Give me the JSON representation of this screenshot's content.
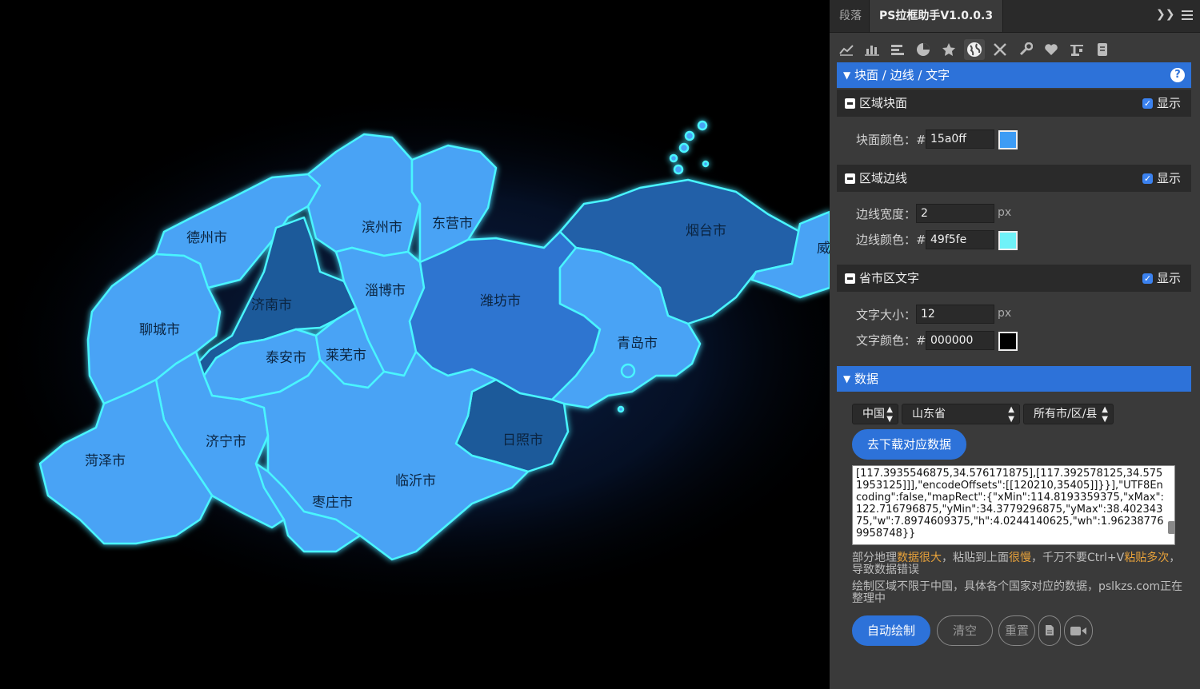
{
  "map": {
    "labels": [
      {
        "id": "dezhou",
        "text": "德州市"
      },
      {
        "id": "binzhou",
        "text": "滨州市"
      },
      {
        "id": "dongying",
        "text": "东营市"
      },
      {
        "id": "yantai",
        "text": "烟台市"
      },
      {
        "id": "weihai",
        "text": "威"
      },
      {
        "id": "jinan",
        "text": "济南市"
      },
      {
        "id": "zibo",
        "text": "淄博市"
      },
      {
        "id": "weifang",
        "text": "潍坊市"
      },
      {
        "id": "liaocheng",
        "text": "聊城市"
      },
      {
        "id": "taian",
        "text": "泰安市"
      },
      {
        "id": "laiwu",
        "text": "莱芜市"
      },
      {
        "id": "qingdao",
        "text": "青岛市"
      },
      {
        "id": "rizhao",
        "text": "日照市"
      },
      {
        "id": "jining",
        "text": "济宁市"
      },
      {
        "id": "heze",
        "text": "菏泽市"
      },
      {
        "id": "linyi",
        "text": "临沂市"
      },
      {
        "id": "zaozhuang",
        "text": "枣庄市"
      }
    ],
    "colors": {
      "fill_light": "#4aa3f5",
      "fill_mid": "#2d74d0",
      "fill_dark": "#1d5a9a",
      "border": "#49f5fe"
    }
  },
  "panel": {
    "tabs": {
      "inactive": "段落",
      "active": "PS拉框助手V1.0.0.3"
    },
    "toolbar_icons": [
      "line-chart-icon",
      "bar-chart-icon",
      "hbar-chart-icon",
      "pie-chart-icon",
      "star-icon",
      "globe-icon",
      "tools-icon",
      "wrench-icon",
      "heart-icon",
      "crane-icon",
      "document-icon"
    ],
    "section1": {
      "title": "块面 / 边线 / 文字"
    },
    "region_fill": {
      "title": "区域块面",
      "show_label": "显示",
      "color_label": "块面颜色：#",
      "color_value": "15a0ff",
      "swatch": "#3d9cf5"
    },
    "region_border": {
      "title": "区域边线",
      "show_label": "显示",
      "width_label": "边线宽度：",
      "width_value": "2",
      "width_unit": "px",
      "color_label": "边线颜色：#",
      "color_value": "49f5fe",
      "swatch": "#6ff2f8"
    },
    "region_text": {
      "title": "省市区文字",
      "show_label": "显示",
      "size_label": "文字大小：",
      "size_value": "12",
      "size_unit": "px",
      "color_label": "文字颜色：#",
      "color_value": "000000",
      "swatch": "#000000"
    },
    "section2": {
      "title": "数据"
    },
    "selects": {
      "country": "中国",
      "province": "山东省",
      "district": "所有市/区/县"
    },
    "download_button": "去下载对应数据",
    "json_text": "[117.3935546875,34.576171875],[117.392578125,34.5751953125]]],\"encodeOffsets\":[[120210,35405]]}}],\"UTF8Encoding\":false,\"mapRect\":{\"xMin\":114.8193359375,\"xMax\":122.716796875,\"yMin\":34.3779296875,\"yMax\":38.40234375,\"w\":7.8974609375,\"h\":4.0244140625,\"wh\":1.962387769958748}}",
    "note1": {
      "p1": "部分地理",
      "h1": "数据很大",
      "p2": "，粘贴到上面",
      "h2": "很慢",
      "p3": "，千万不要Ctrl+V",
      "h3": "粘贴多次",
      "p4": "，导致数据错误"
    },
    "note2": "绘制区域不限于中国，具体各个国家对应的数据，pslkzs.com正在整理中",
    "buttons": {
      "auto_draw": "自动绘制",
      "clear": "清空",
      "reset": "重置"
    }
  }
}
